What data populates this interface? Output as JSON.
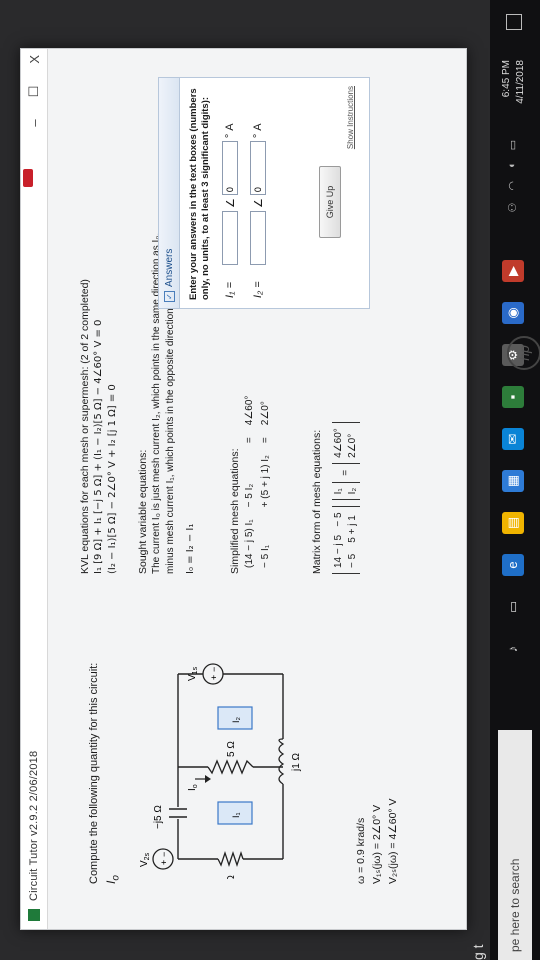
{
  "window": {
    "title": "Circuit Tutor v2.9.2  2/06/2018",
    "minimize": "–",
    "restore": "☐",
    "close": "X"
  },
  "problem": {
    "prompt": "Compute the following quantity for this circuit:",
    "target": "I",
    "target_sub": "o",
    "circuit_labels": {
      "cap": "−j5 Ω",
      "res_left": "9 Ω",
      "res_mid": "5 Ω",
      "ind": "j1 Ω",
      "vs_left": "V",
      "vs_left_sub": "2s",
      "vs_right": "V",
      "vs_right_sub": "1s",
      "i_o": "I",
      "i_o_sub": "o",
      "mesh1": "I₁",
      "mesh2": "I₂"
    },
    "params": [
      "ω = 0.9 krad/s",
      "V₁ₛ(jω) = 2∠0° V",
      "V₂ₛ(jω) = 4∠60° V"
    ]
  },
  "kvl": {
    "heading": "KVL equations for each mesh or supermesh:  (2 of 2 completed)",
    "eq1": "I₁ [9 Ω] + I₁ [−j 5 Ω] + (I₁ − I₂)[5 Ω] − 4∠60° V = 0",
    "eq2": "(I₂ − I₁)[5 Ω] − 2∠0° V + I₂ [j 1 Ω] = 0"
  },
  "sought": {
    "heading": "Sought variable equations:",
    "line1": "The current I₀ is just mesh current I₂, which points in the same direction as I₀,",
    "line2": "minus mesh current I₁, which points in the opposite direction.",
    "eq": "I₀ = I₂ − I₁"
  },
  "simplified": {
    "heading": "Simplified mesh equations:",
    "rows": [
      [
        "(14 − j 5) I₁",
        "− 5 I₂",
        "=",
        "4∠60°"
      ],
      [
        "− 5 I₁",
        "+ (5 + j 1) I₂",
        "=",
        "2∠0°"
      ]
    ]
  },
  "matrix": {
    "heading": "Matrix form of mesh equations:",
    "A": [
      [
        "14 − j 5",
        "− 5"
      ],
      [
        "− 5",
        "5 + j 1"
      ]
    ],
    "x": [
      "I₁",
      "I₂"
    ],
    "equals": "=",
    "b": [
      "4∠60°",
      "2∠0°"
    ]
  },
  "answers": {
    "header": "Answers",
    "instructions": "Enter your answers in the text boxes (numbers only, no units, to at least 3 significant digits):",
    "rows": [
      {
        "label": "I₁ =",
        "mag": "",
        "angle_sym": "∠",
        "phase": "0",
        "deg": "°",
        "unit": "A"
      },
      {
        "label": "I₂ =",
        "mag": "",
        "angle_sym": "∠",
        "phase": "0",
        "deg": "°",
        "unit": "A"
      }
    ],
    "give_up": "Give Up",
    "show_instructions": "Show Instructions"
  },
  "taskbar": {
    "search": "pe here to search",
    "time": "6:45 PM",
    "date": "4/11/2018",
    "edge_glyph": "g t",
    "brand": "hp"
  }
}
